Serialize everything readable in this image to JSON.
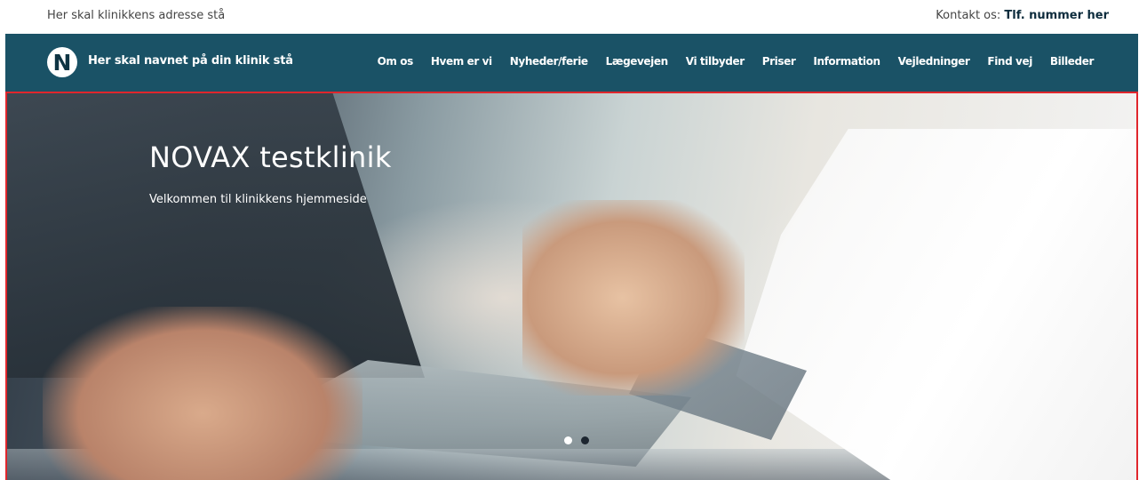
{
  "topbar": {
    "address": "Her skal klinikkens adresse stå",
    "contact_label": "Kontakt os: ",
    "contact_phone": "Tlf. nummer her"
  },
  "header": {
    "logo_letter": "N",
    "brand": "Her skal navnet på din klinik stå",
    "nav": [
      "Om os",
      "Hvem er vi",
      "Nyheder/ferie",
      "Lægevejen",
      "Vi tilbyder",
      "Priser",
      "Information",
      "Vejledninger",
      "Find vej",
      "Billeder"
    ]
  },
  "hero": {
    "title": "NOVAX testklinik",
    "subtitle": "Velkommen til klinikkens hjemmeside",
    "slides": 2,
    "active_slide": 1
  },
  "colors": {
    "navbar": "#1a5266",
    "hero_border": "#e0262c"
  }
}
